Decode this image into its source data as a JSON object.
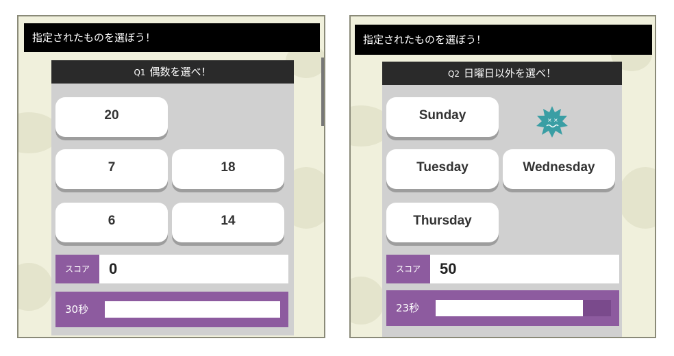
{
  "panels": [
    {
      "header": "指定されたものを選ぼう！",
      "question_number": "Q1",
      "question": "偶数を選べ！",
      "choices": [
        "20",
        "7",
        "18",
        "6",
        "14"
      ],
      "score_label": "スコア",
      "score": "0",
      "timer_label": "30秒",
      "timer_fraction": 1.0
    },
    {
      "header": "指定されたものを選ぼう！",
      "question_number": "Q2",
      "question": "日曜日以外を選べ！",
      "choices": [
        "Sunday",
        "Tuesday",
        "Wednesday",
        "Thursday"
      ],
      "feedback_icon": "virus-icon",
      "score_label": "スコア",
      "score": "50",
      "timer_label": "23秒",
      "timer_fraction": 0.84
    }
  ],
  "colors": {
    "header_bg": "#000000",
    "question_bg": "#2a2a2a",
    "accent_purple": "#8d5b9f",
    "board_bg": "#d0d0d0",
    "page_bg": "#f0f0dc",
    "virus_teal": "#3a9ea4"
  }
}
